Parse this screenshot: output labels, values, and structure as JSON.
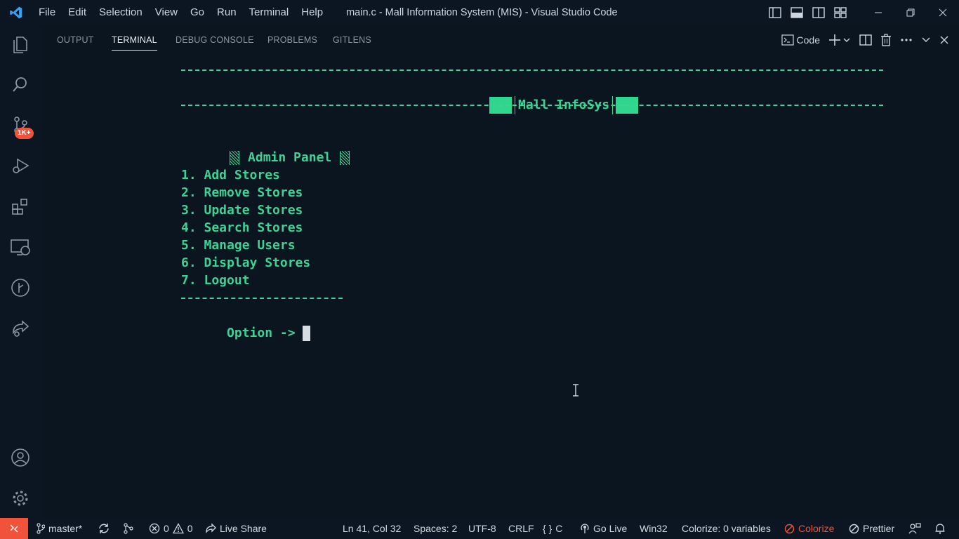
{
  "titlebar": {
    "menu": [
      "File",
      "Edit",
      "Selection",
      "View",
      "Go",
      "Run",
      "Terminal",
      "Help"
    ],
    "window_title": "main.c - Mall Information System (MIS) - Visual Studio Code"
  },
  "activitybar": {
    "scm_badge": "1K+"
  },
  "panel": {
    "tabs": [
      "OUTPUT",
      "TERMINAL",
      "DEBUG CONSOLE",
      "PROBLEMS",
      "GITLENS"
    ],
    "active_tab": "TERMINAL",
    "shell_label": "Code"
  },
  "terminal": {
    "banner_title": "Mall InfoSys",
    "panel_title": "Admin Panel",
    "options": [
      "1. Add Stores",
      "2. Remove Stores",
      "3. Update Stores",
      "4. Search Stores",
      "5. Manage Users",
      "6. Display Stores",
      "7. Logout"
    ],
    "prompt": "Option ->",
    "text_color": "#3ed295"
  },
  "statusbar": {
    "branch": "master*",
    "errors": "0",
    "warnings": "0",
    "live_share": "Live Share",
    "position": "Ln 41, Col 32",
    "spaces": "Spaces: 2",
    "encoding": "UTF-8",
    "eol": "CRLF",
    "language": "C",
    "go_live": "Go Live",
    "platform": "Win32",
    "colorize_vars": "Colorize: 0 variables",
    "colorize": "Colorize",
    "prettier": "Prettier",
    "accent": "#f0533a"
  }
}
